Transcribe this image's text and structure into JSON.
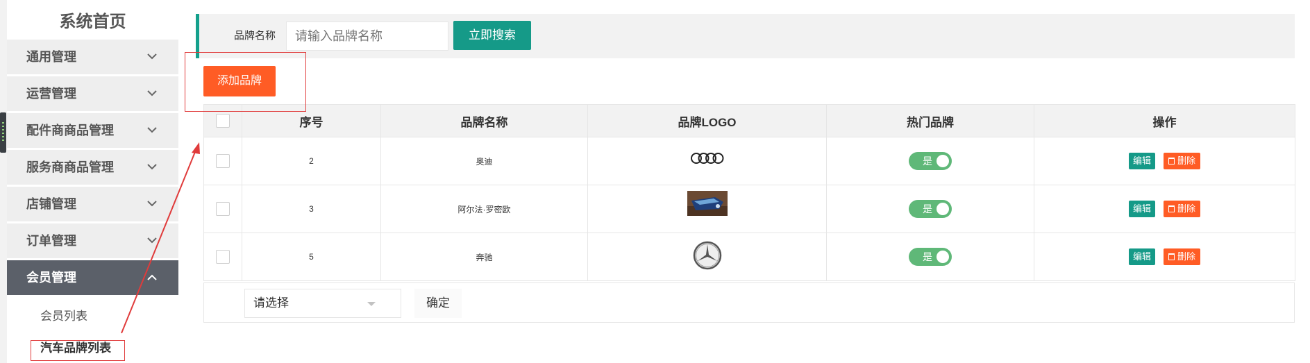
{
  "sidebar": {
    "title": "系统首页",
    "menu": [
      {
        "label": "通用管理"
      },
      {
        "label": "运营管理"
      },
      {
        "label": "配件商商品管理"
      },
      {
        "label": "服务商商品管理"
      },
      {
        "label": "店铺管理"
      },
      {
        "label": "订单管理"
      },
      {
        "label": "会员管理"
      }
    ],
    "submenu": [
      {
        "label": "会员列表"
      },
      {
        "label": "汽车品牌列表"
      }
    ]
  },
  "search": {
    "label": "品牌名称",
    "placeholder": "请输入品牌名称",
    "button": "立即搜索"
  },
  "toolbar": {
    "add_label": "添加品牌"
  },
  "table": {
    "headers": [
      "序号",
      "品牌名称",
      "品牌LOGO",
      "热门品牌",
      "操作"
    ],
    "rows": [
      {
        "id": "2",
        "name": "奥迪",
        "logo": "audi-logo",
        "hot": "是"
      },
      {
        "id": "3",
        "name": "阿尔法·罗密欧",
        "logo": "alfa-romeo-photo",
        "hot": "是"
      },
      {
        "id": "5",
        "name": "奔驰",
        "logo": "mercedes-logo",
        "hot": "是"
      }
    ],
    "edit_label": "编辑",
    "delete_label": "删除"
  },
  "footer": {
    "select_value": "请选择",
    "confirm_label": "确定"
  },
  "colors": {
    "accent_teal": "#159a88",
    "accent_orange": "#ff5c25",
    "toggle_green": "#5fb878",
    "sidebar_active": "#5b6069",
    "annotation_red": "#e03b3b"
  }
}
